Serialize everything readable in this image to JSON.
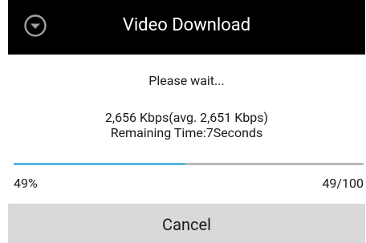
{
  "dialog": {
    "title": "Video Download",
    "title_icon": "chevron-down-circle-icon",
    "message": "Please wait...",
    "speed_text": "2,656 Kbps(avg. 2,651 Kbps)",
    "remaining_text": "Remaining Time:7Seconds"
  },
  "progress": {
    "value": 49,
    "max": 100,
    "percent_label": "49%",
    "count_label": "49/100",
    "fill_color": "#5bb5e0",
    "track_color": "#b9b9b9"
  },
  "actions": {
    "cancel_label": "Cancel"
  }
}
